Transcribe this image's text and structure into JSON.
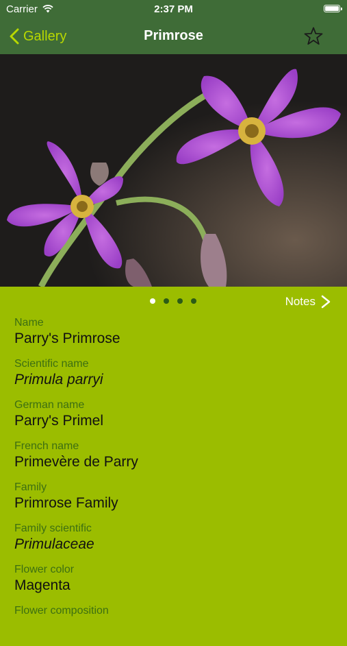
{
  "status_bar": {
    "carrier": "Carrier",
    "time": "2:37 PM"
  },
  "nav": {
    "back_label": "Gallery",
    "title": "Primrose"
  },
  "pager": {
    "page_count": 4,
    "active_index": 0,
    "notes_label": "Notes"
  },
  "details": [
    {
      "label": "Name",
      "value": "Parry's Primrose",
      "italic": false
    },
    {
      "label": "Scientific name",
      "value": "Primula parryi",
      "italic": true
    },
    {
      "label": "German name",
      "value": "Parry's Primel",
      "italic": false
    },
    {
      "label": "French name",
      "value": "Primevère de Parry",
      "italic": false
    },
    {
      "label": "Family",
      "value": "Primrose Family",
      "italic": false
    },
    {
      "label": "Family scientific",
      "value": "Primulaceae",
      "italic": true
    },
    {
      "label": "Flower color",
      "value": "Magenta",
      "italic": false
    },
    {
      "label": "Flower composition",
      "value": "",
      "italic": false
    }
  ],
  "colors": {
    "nav_background": "#3f6c37",
    "content_background": "#9bbd00",
    "accent": "#b8d800",
    "label_text": "#3d6f12",
    "dot_inactive": "#2c5b16"
  },
  "icons": {
    "back": "chevron-left-icon",
    "favorite": "star-outline-icon",
    "notes": "chevron-right-icon",
    "wifi": "wifi-icon",
    "battery": "battery-icon"
  }
}
